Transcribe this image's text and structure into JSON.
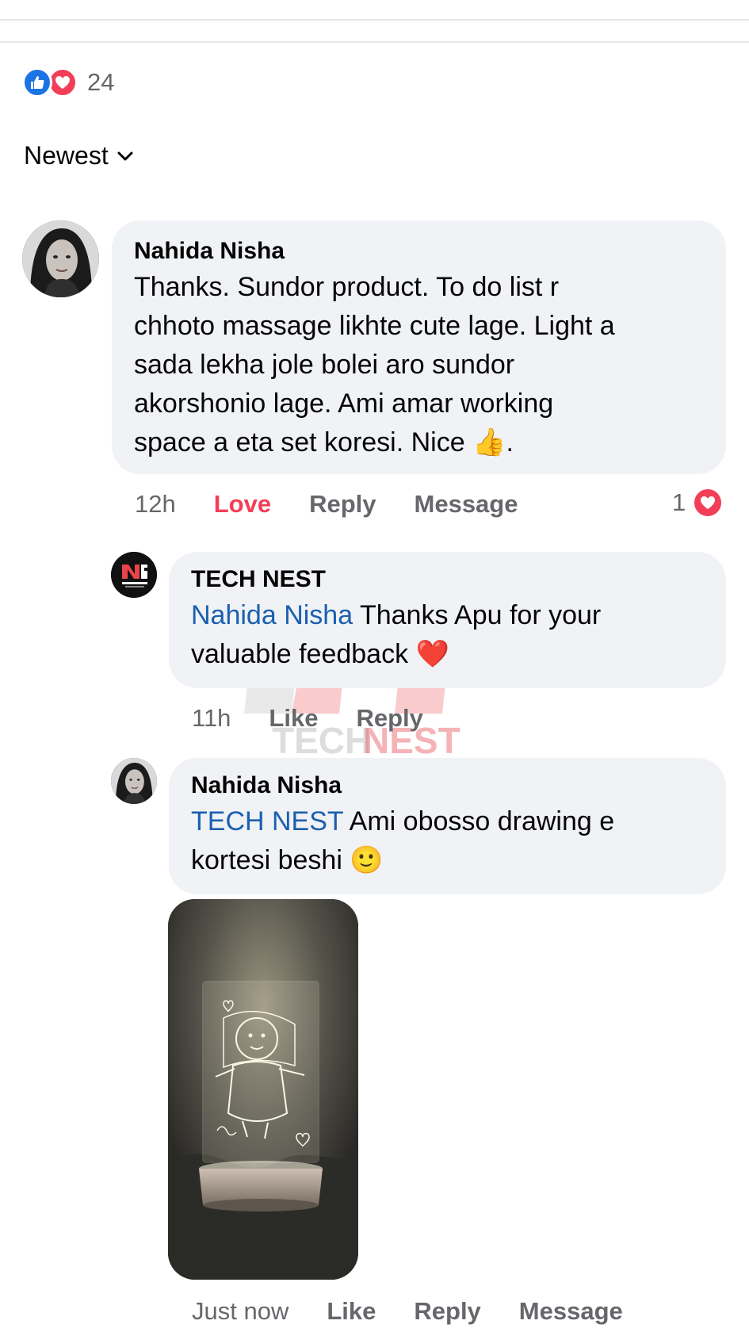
{
  "reactions": {
    "count": "24",
    "icons": [
      "like-icon",
      "love-icon"
    ]
  },
  "sort": {
    "label": "Newest"
  },
  "comments": [
    {
      "author": "Nahida Nisha",
      "lines": [
        "Thanks. Sundor product. To do list r",
        "chhoto massage likhte cute lage. Light a",
        "sada lekha jole bolei aro sundor",
        "akorshonio lage. Ami amar working",
        "space a eta set koresi. Nice"
      ],
      "emoji": "👍",
      "trailing": ".",
      "time": "12h",
      "love_label": "Love",
      "reply_label": "Reply",
      "message_label": "Message",
      "reaction_count": "1"
    },
    {
      "author": "TECH NEST",
      "mention": "Nahida Nisha",
      "line1": "Thanks Apu for your",
      "line2": "valuable feedback",
      "emoji": "❤️",
      "time": "11h",
      "like_label": "Like",
      "reply_label": "Reply"
    },
    {
      "author": "Nahida Nisha",
      "mention": "TECH NEST",
      "line1": "Ami obosso drawing e",
      "line2": "kortesi beshi",
      "emoji": "🙂",
      "time": "Just now",
      "like_label": "Like",
      "reply_label": "Reply",
      "message_label": "Message"
    }
  ],
  "watermark": {
    "text_left": "TECH",
    "text_right": "NEST"
  },
  "colors": {
    "accent_blue": "#1b74e4",
    "love_red": "#f33e58",
    "mention_blue": "#1b5fb0",
    "bubble_bg": "#f0f2f5",
    "meta_gray": "#65676b"
  }
}
